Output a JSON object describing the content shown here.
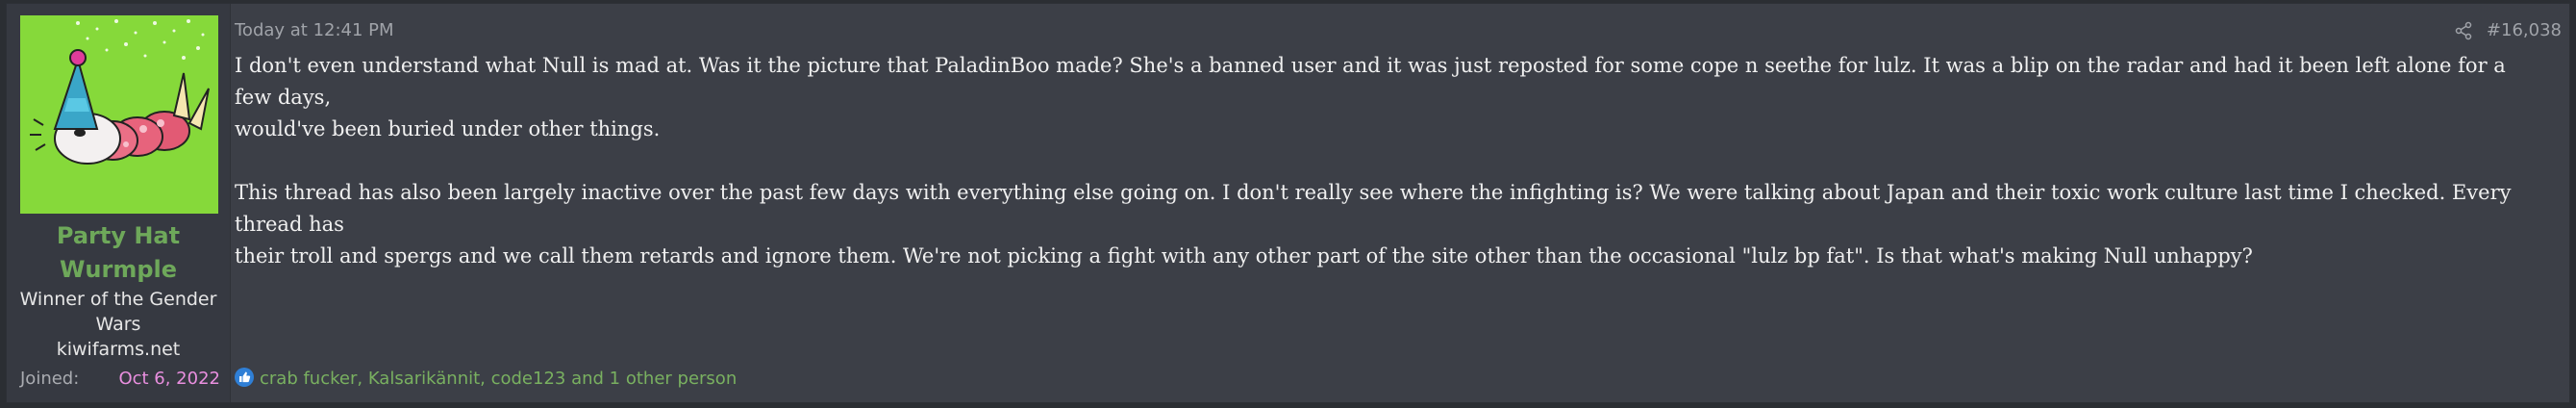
{
  "user": {
    "username_line1": "Party Hat",
    "username_line2": "Wurmple",
    "title_line1": "Winner of the Gender",
    "title_line2": "Wars",
    "title_line3": "kiwifarms.net",
    "joined_label": "Joined:",
    "joined_date": "Oct 6, 2022",
    "username_color": "#6ea85a",
    "joined_date_color": "#e98fdf"
  },
  "post": {
    "date": "Today at 12:41 PM",
    "number": "#16,038",
    "paragraph1_line1": "I don't even understand what Null is mad at. Was it the picture that PaladinBoo made? She's a banned user and it was just reposted for some cope n seethe for lulz. It was a blip on the radar and had it been left alone for a few days,",
    "paragraph1_line2": "would've been buried under other things.",
    "paragraph2_line1": "This thread has also been largely inactive over the past few days with everything else going on. I don't really see where the infighting is? We were talking about Japan and their toxic work culture last time I checked. Every thread has",
    "paragraph2_line2": "their troll and spergs and we call them retards and ignore them. We're not picking a fight with any other part of the site other than the occasional \"lulz bp fat\". Is that what's making Null unhappy?"
  },
  "reactions": {
    "text": "crab fucker, Kalsarikännit, code123 and 1 other person",
    "icon": "like-icon",
    "color": "#79b060"
  },
  "icons": {
    "share": "share-icon",
    "avatar": "party-hat-wurmple-avatar"
  }
}
